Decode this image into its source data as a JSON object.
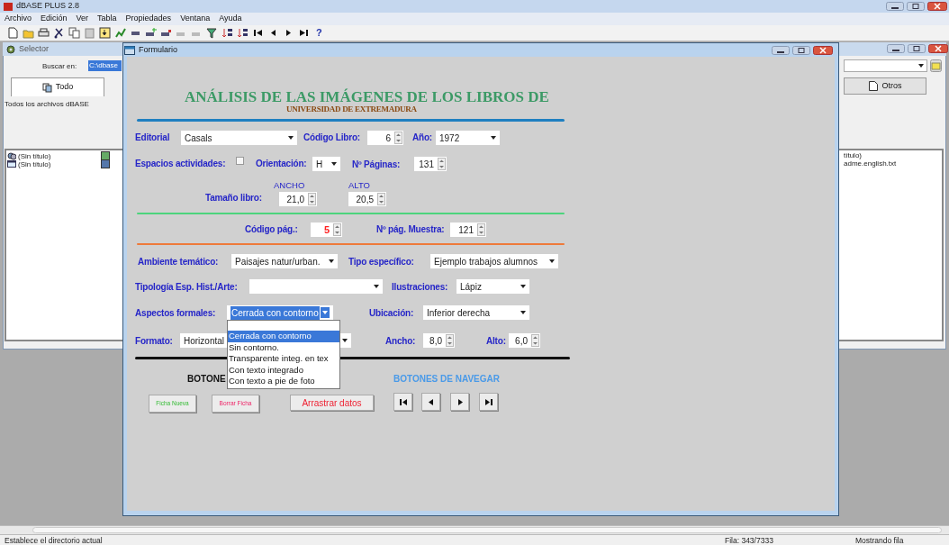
{
  "app": {
    "title": "dBASE PLUS 2.8"
  },
  "menu": [
    "Archivo",
    "Edición",
    "Ver",
    "Tabla",
    "Propiedades",
    "Ventana",
    "Ayuda"
  ],
  "toolbar": {
    "help": "?"
  },
  "selector": {
    "title": "Selector",
    "search_label": "Buscar en:",
    "search_value": "C:\\dbase",
    "filter_label": "Todos los archivos dBASE",
    "tabs": [
      {
        "label": "Todo",
        "selected": true
      },
      {
        "label": "Otros",
        "selected": false
      }
    ],
    "files": [
      {
        "name": "(Sin título)",
        "kind": "query"
      },
      {
        "name": "(Sin título)",
        "kind": "form"
      }
    ],
    "right_files": [
      "título)",
      "adme.english.txt"
    ]
  },
  "form": {
    "title": "Formulario",
    "heading": "ANÁLISIS DE LAS IMÁGENES DE LOS LIBROS DE",
    "subheading": "UNIVERSIDAD DE EXTREMADURA",
    "fields": [
      {
        "kind": "label",
        "text": "Editorial"
      },
      {
        "kind": "combo",
        "value": "Casals"
      },
      {
        "kind": "label",
        "text": "Código Libro:"
      },
      {
        "kind": "spinner",
        "value": "6"
      },
      {
        "kind": "label",
        "text": "Año:"
      },
      {
        "kind": "combo",
        "value": "1972"
      },
      {
        "kind": "label",
        "text": "Espacios actividades:"
      },
      {
        "kind": "checkbox",
        "checked": false
      },
      {
        "kind": "label",
        "text": "Orientación:"
      },
      {
        "kind": "combo",
        "value": "H"
      },
      {
        "kind": "label",
        "text": "Nº Páginas:"
      },
      {
        "kind": "spinner",
        "value": "131"
      },
      {
        "kind": "caption",
        "text": "ANCHO"
      },
      {
        "kind": "caption",
        "text": "ALTO"
      },
      {
        "kind": "label",
        "text": "Tamaño libro:"
      },
      {
        "kind": "spinner",
        "value": "21,0"
      },
      {
        "kind": "spinner",
        "value": "20,5"
      },
      {
        "kind": "label",
        "text": "Código pág.:"
      },
      {
        "kind": "spinner",
        "value": "5",
        "color": "#ff2020"
      },
      {
        "kind": "label",
        "text": "Nº pág. Muestra:"
      },
      {
        "kind": "spinner",
        "value": "121"
      },
      {
        "kind": "label",
        "text": "Ambiente temático:"
      },
      {
        "kind": "combo",
        "value": "Paisajes natur/urban."
      },
      {
        "kind": "label",
        "text": "Tipo específico:"
      },
      {
        "kind": "combo",
        "value": "Ejemplo trabajos alumnos"
      },
      {
        "kind": "label",
        "text": "Tipología Esp. Hist./Arte:"
      },
      {
        "kind": "combo"
      },
      {
        "kind": "label",
        "text": "Ilustraciones:"
      },
      {
        "kind": "combo",
        "value": "Lápiz"
      },
      {
        "kind": "label",
        "text": "Aspectos formales:"
      },
      {
        "kind": "combo",
        "value": "Cerrada con contorno",
        "open": true
      },
      {
        "kind": "label",
        "text": "Ubicación:"
      },
      {
        "kind": "combo",
        "value": "Inferior derecha"
      },
      {
        "kind": "label",
        "text": "Formato:"
      },
      {
        "kind": "combo",
        "value": "Horizontal"
      },
      {
        "kind": "label",
        "text": "Ancho:"
      },
      {
        "kind": "spinner",
        "value": "8,0"
      },
      {
        "kind": "label",
        "text": "Alto:"
      },
      {
        "kind": "spinner",
        "value": "6,0"
      }
    ],
    "dropdown": [
      {
        "label": "Cerrada con contorno",
        "selected": true
      },
      {
        "label": "Sin contorno.",
        "selected": false
      },
      {
        "label": "Transparente integ. en tex",
        "selected": false
      },
      {
        "label": "Con texto integrado",
        "selected": false
      },
      {
        "label": "Con texto a pie de foto",
        "selected": false
      }
    ],
    "buttons_heading": "BOTONE",
    "nav_heading": "BOTONES DE NAVEGAR",
    "buttons": [
      {
        "label": "Ficha Nueva",
        "kind": "new"
      },
      {
        "label": "Borrar Ficha",
        "kind": "delete"
      },
      {
        "label": "Arrastrar datos",
        "kind": "drag"
      }
    ]
  },
  "status_bar": [
    "Establece el directorio actual",
    "Fila: 343/7333",
    "Mostrando fila"
  ]
}
